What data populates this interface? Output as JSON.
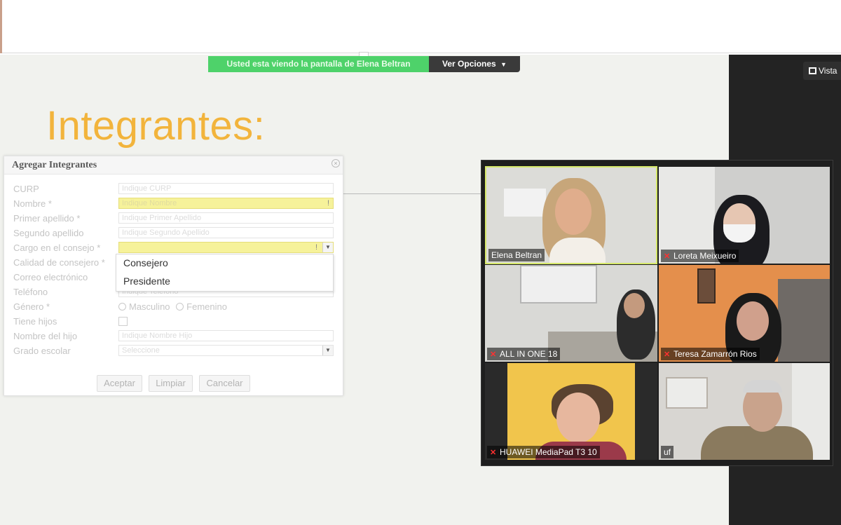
{
  "share_bar": {
    "banner_text": "Usted esta viendo la pantalla de Elena Beltran",
    "view_options_label": "Ver Opciones"
  },
  "side_controls": {
    "view_label": "Vista"
  },
  "slide": {
    "title": "Integrantes:"
  },
  "dialog": {
    "title": "Agregar Integrantes",
    "fields": [
      {
        "label": "CURP",
        "placeholder": "Indique CURP"
      },
      {
        "label": "Nombre *",
        "placeholder": "Indique Nombre"
      },
      {
        "label": "Primer apellido *",
        "placeholder": "Indique Primer Apellido"
      },
      {
        "label": "Segundo apellido",
        "placeholder": "Indique Segundo Apellido"
      },
      {
        "label": "Cargo en el consejo *",
        "placeholder": ""
      },
      {
        "label": "Calidad de consejero *",
        "placeholder": ""
      },
      {
        "label": "Correo electrónico",
        "placeholder": ""
      },
      {
        "label": "Teléfono",
        "placeholder": "Indique Teléfono"
      },
      {
        "label": "Género *",
        "placeholder": ""
      },
      {
        "label": "Tiene hijos",
        "placeholder": ""
      },
      {
        "label": "Nombre del hijo",
        "placeholder": "Indique Nombre Hijo"
      },
      {
        "label": "Grado escolar",
        "placeholder": "Seleccione"
      }
    ],
    "gender_options": [
      "Masculino",
      "Femenino"
    ],
    "dropdown_options": [
      "Consejero",
      "Presidente"
    ],
    "buttons": {
      "accept": "Aceptar",
      "clear": "Limpiar",
      "cancel": "Cancelar"
    }
  },
  "participants": [
    {
      "name": "Elena Beltran",
      "muted": false,
      "active_speaker": true
    },
    {
      "name": "Loreta Meixueiro",
      "muted": true,
      "active_speaker": false
    },
    {
      "name": "ALL IN ONE 18",
      "muted": true,
      "active_speaker": false
    },
    {
      "name": "Teresa Zamarrón Rios",
      "muted": true,
      "active_speaker": false
    },
    {
      "name": "HUAWEI MediaPad T3 10",
      "muted": true,
      "active_speaker": false
    },
    {
      "name": "uf",
      "muted": false,
      "active_speaker": false
    }
  ],
  "colors": {
    "share_banner": "#4ed26a",
    "slide_title": "#f2b43c",
    "required_field": "#f6f29a",
    "active_speaker_border": "#d6e86a",
    "muted_icon": "#ff3030"
  }
}
